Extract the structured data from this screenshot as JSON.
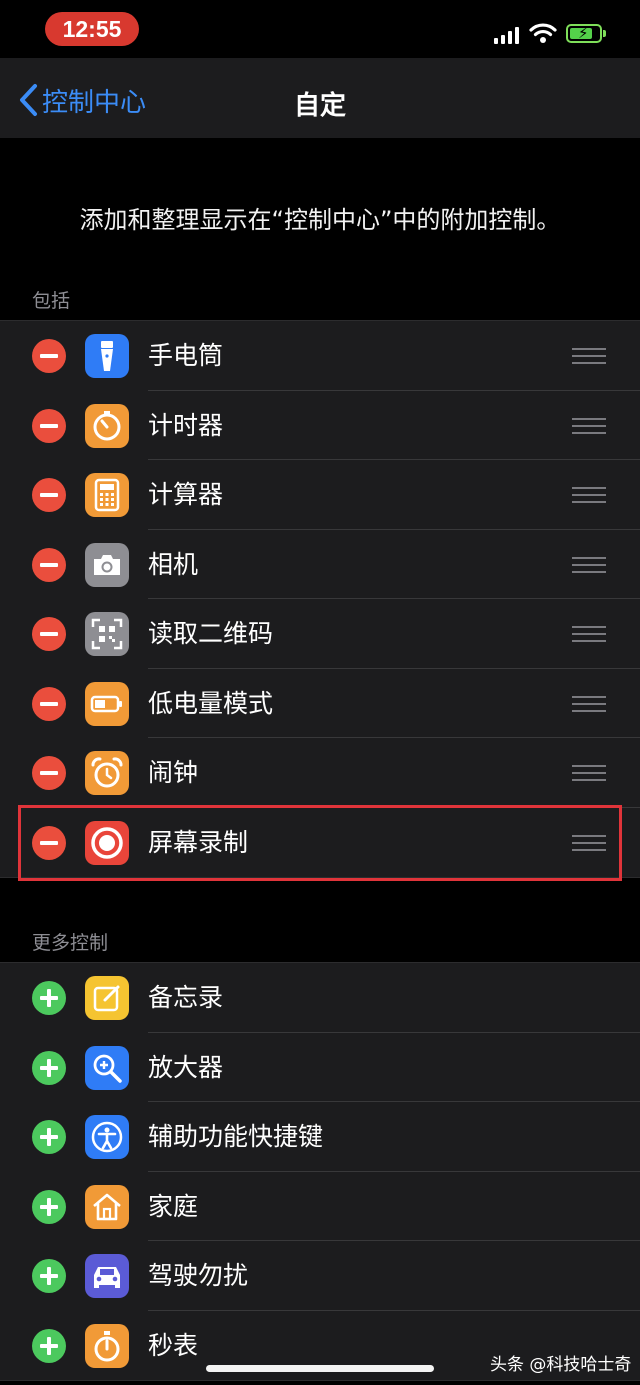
{
  "status_bar": {
    "time": "12:55",
    "battery_charging": true
  },
  "nav": {
    "back_label": "控制中心",
    "title": "自定"
  },
  "description": "添加和整理显示在“控制中心”中的附加控制。",
  "included": {
    "header": "包括",
    "items": [
      {
        "label": "手电筒",
        "icon": "flashlight-icon",
        "color": "#2f7cf6"
      },
      {
        "label": "计时器",
        "icon": "timer-icon",
        "color": "#f19a37"
      },
      {
        "label": "计算器",
        "icon": "calculator-icon",
        "color": "#f19a37"
      },
      {
        "label": "相机",
        "icon": "camera-icon",
        "color": "#8e8e93"
      },
      {
        "label": "读取二维码",
        "icon": "qr-code-icon",
        "color": "#8e8e93"
      },
      {
        "label": "低电量模式",
        "icon": "battery-icon",
        "color": "#f19a37"
      },
      {
        "label": "闹钟",
        "icon": "alarm-clock-icon",
        "color": "#f19a37"
      },
      {
        "label": "屏幕录制",
        "icon": "screen-record-icon",
        "color": "#e9453a"
      }
    ]
  },
  "more": {
    "header": "更多控制",
    "items": [
      {
        "label": "备忘录",
        "icon": "notes-icon",
        "color": "#f5c431"
      },
      {
        "label": "放大器",
        "icon": "magnifier-icon",
        "color": "#2f7cf6"
      },
      {
        "label": "辅助功能快捷键",
        "icon": "accessibility-icon",
        "color": "#2f7cf6"
      },
      {
        "label": "家庭",
        "icon": "home-icon",
        "color": "#f19a37"
      },
      {
        "label": "驾驶勿扰",
        "icon": "car-icon",
        "color": "#5b5bd6"
      },
      {
        "label": "秒表",
        "icon": "stopwatch-icon",
        "color": "#f19a37"
      }
    ]
  },
  "watermark": "头条 @科技哈士奇"
}
